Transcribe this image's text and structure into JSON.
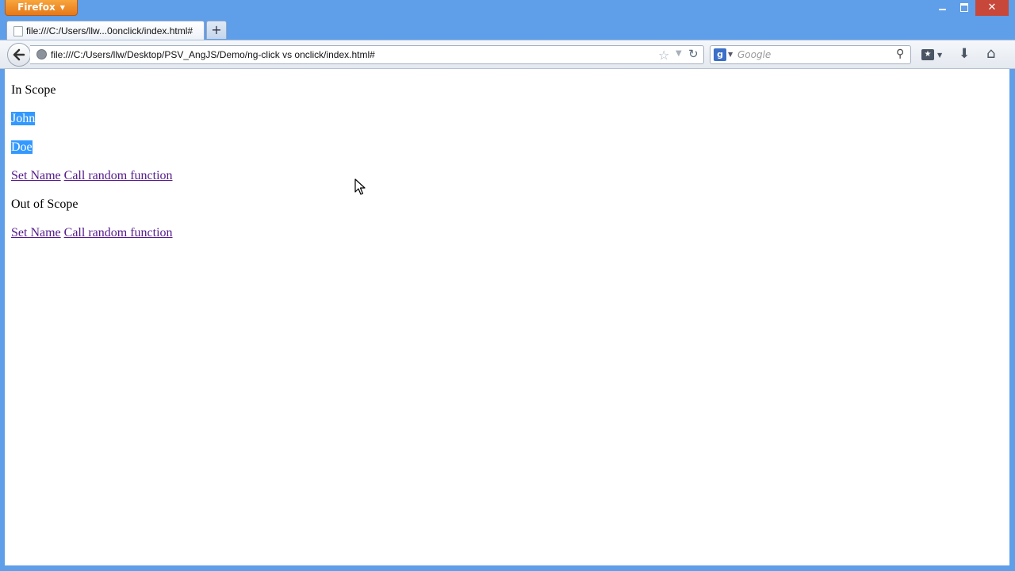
{
  "browser": {
    "app_button": "Firefox",
    "tab_title": "file:///C:/Users/llw...0onclick/index.html#",
    "url": "file:///C:/Users/llw/Desktop/PSV_AngJS/Demo/ng-click vs onclick/index.html#",
    "search_placeholder": "Google",
    "search_engine_glyph": "g"
  },
  "page": {
    "in_scope_heading": "In Scope",
    "first_name": "John",
    "last_name": "Doe",
    "in_scope_links": [
      "Set Name",
      "Call random function"
    ],
    "out_scope_heading": "Out of Scope",
    "out_scope_links": [
      "Set Name",
      "Call random function"
    ]
  },
  "colors": {
    "chrome": "#5f9ee8",
    "selection": "#3399ff",
    "visited_link": "#551a8b",
    "firefox_button": "#e6781a"
  }
}
